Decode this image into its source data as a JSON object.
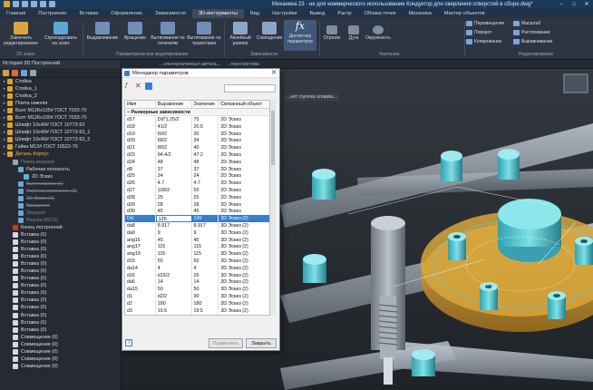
{
  "window": {
    "title": "Механика 23 - не для коммерческого использования Кондуктор для сверления отверстий в сборе.dwg*",
    "minimize": "–",
    "maximize": "□",
    "close": "✕"
  },
  "ribbon_tabs": [
    "Главная",
    "Построение",
    "Вставка",
    "Оформление",
    "Зависимости",
    "3D-инструменты",
    "Вид",
    "Настройки",
    "Вывод",
    "Растр",
    "Облака точек",
    "Механика",
    "Мастер объектов"
  ],
  "ribbon_active_tab": "3D-инструменты",
  "ribbon": {
    "buttons": [
      {
        "name": "close-editing",
        "label": "Закончить редактирование",
        "color": "#d9a441"
      },
      {
        "name": "project-sketch",
        "label": "Спроецировать на эскиз",
        "color": "#5aa6d6"
      },
      {
        "name": "extrude",
        "label": "Выдавливание",
        "color": "#6f8fb8"
      },
      {
        "name": "revolve",
        "label": "Вращение",
        "color": "#6f8fb8"
      },
      {
        "name": "loft",
        "label": "Вытягивание по сечениям",
        "color": "#6f8fb8"
      },
      {
        "name": "sweep",
        "label": "Вытягивание по траектории",
        "color": "#6f8fb8"
      },
      {
        "name": "linear-pattern",
        "label": "Линейный размер",
        "color": "#8aa6c9"
      },
      {
        "name": "coincidence",
        "label": "Совпадение",
        "color": "#8aa6c9"
      },
      {
        "name": "param-manager",
        "label": "Диспетчер параметров",
        "color": "#3f78c4"
      }
    ],
    "groups": {
      "sketch": "2D эскиз",
      "param": "Параметрическое моделирование",
      "constraints": "Зависимости",
      "drawing": "Черчение",
      "edit": "Редактирование"
    },
    "draw_tools": [
      "Отрезок",
      "Дуга",
      "Окружность"
    ],
    "edit_tools": [
      "Перемещение",
      "Поворот",
      "Копирование",
      "Масштаб",
      "Растягивание",
      "Выравнивание"
    ]
  },
  "left_panel": {
    "title": "История 3D Построений",
    "items": [
      {
        "label": "Стойка",
        "kind": "body",
        "state": "normal"
      },
      {
        "label": "Стойка_1",
        "kind": "body",
        "state": "normal"
      },
      {
        "label": "Стойка_2",
        "kind": "body",
        "state": "normal"
      },
      {
        "label": "Плита нижняя",
        "kind": "body",
        "state": "normal"
      },
      {
        "label": "Болт М12Кх125# ГОСТ 7033-70",
        "kind": "body",
        "state": "normal"
      },
      {
        "label": "Болт М12Кх100# ГОСТ 7033-70",
        "kind": "body",
        "state": "normal"
      },
      {
        "label": "Шпифт 10х40# ГОСТ 10773-93",
        "kind": "body",
        "state": "normal"
      },
      {
        "label": "Шпифт 10х40# ГОСТ 10773-93_1",
        "kind": "body",
        "state": "normal"
      },
      {
        "label": "Шпифт 10х40# ГОСТ 10773-93_2",
        "kind": "body",
        "state": "normal"
      },
      {
        "label": "Гайка М12# ГОСТ 15522-70",
        "kind": "body",
        "state": "normal"
      },
      {
        "label": "Деталь Корпус",
        "kind": "body",
        "state": "highlight"
      },
      {
        "label": "Плита верхняя",
        "kind": "sub",
        "state": "gray"
      },
      {
        "label": "Рабочая плоскость",
        "kind": "sub2",
        "state": "normal"
      },
      {
        "label": "2D Эскиз",
        "kind": "sub3",
        "state": "normal"
      },
      {
        "label": "Вытягивание (1)",
        "kind": "sub2",
        "state": "strike"
      },
      {
        "label": "Рабочая плоскость (2)",
        "kind": "sub2",
        "state": "strike"
      },
      {
        "label": "3D Эскиз (2)",
        "kind": "sub2",
        "state": "strike"
      },
      {
        "label": "Вращение",
        "kind": "sub2",
        "state": "strike"
      },
      {
        "label": "Зеркало",
        "kind": "sub2",
        "state": "gray"
      },
      {
        "label": "Резьба (8X12)",
        "kind": "sub2",
        "state": "gray"
      },
      {
        "label": "Конец построений",
        "kind": "end",
        "state": "normal"
      },
      {
        "label": "Вставка (0)",
        "kind": "ins",
        "state": "normal"
      },
      {
        "label": "Вставка (0)",
        "kind": "ins",
        "state": "normal"
      },
      {
        "label": "Вставка (0)",
        "kind": "ins",
        "state": "normal"
      },
      {
        "label": "Вставка (0)",
        "kind": "ins",
        "state": "normal"
      },
      {
        "label": "Вставка (0)",
        "kind": "ins",
        "state": "normal"
      },
      {
        "label": "Вставка (0)",
        "kind": "ins",
        "state": "normal"
      },
      {
        "label": "Вставка (0)",
        "kind": "ins",
        "state": "normal"
      },
      {
        "label": "Вставка (0)",
        "kind": "ins",
        "state": "normal"
      },
      {
        "label": "Вставка (0)",
        "kind": "ins",
        "state": "normal"
      },
      {
        "label": "Вставка (0)",
        "kind": "ins",
        "state": "normal"
      },
      {
        "label": "Вставка (0)",
        "kind": "ins",
        "state": "normal"
      },
      {
        "label": "Вставка (0)",
        "kind": "ins",
        "state": "normal"
      },
      {
        "label": "Вставка (0)",
        "kind": "ins",
        "state": "normal"
      },
      {
        "label": "Вставка (0)",
        "kind": "ins",
        "state": "normal"
      },
      {
        "label": "Совмещение (0)",
        "kind": "ins",
        "state": "normal"
      },
      {
        "label": "Совмещение (0)",
        "kind": "ins",
        "state": "normal"
      },
      {
        "label": "Совмещение (0)",
        "kind": "ins",
        "state": "normal"
      },
      {
        "label": "Совмещение (0)",
        "kind": "ins",
        "state": "normal"
      },
      {
        "label": "Совмещение (0)",
        "kind": "ins",
        "state": "normal"
      }
    ]
  },
  "viewport": {
    "doc_tab": "...эльтернатиеныт-деталь...",
    "view_label": "...перспектива",
    "hint_label": "...нет горячих клавиш..."
  },
  "dialog": {
    "title": "Менеджер параметров",
    "close": "✕",
    "columns": [
      "Имя",
      "Выражение",
      "Значение",
      "Связанный объект"
    ],
    "section": "Размерные зависимости",
    "rows": [
      {
        "name": "d17",
        "expr": "Dd*1.25/2",
        "value": "75",
        "obj": "2D Эскиз"
      },
      {
        "name": "d18",
        "expr": "41/2",
        "value": "20.5",
        "obj": "2D Эскиз"
      },
      {
        "name": "d19",
        "expr": "60/2",
        "value": "30",
        "obj": "2D Эскиз"
      },
      {
        "name": "d20",
        "expr": "68/2",
        "value": "34",
        "obj": "2D Эскиз"
      },
      {
        "name": "d21",
        "expr": "80/2",
        "value": "40",
        "obj": "2D Эскиз"
      },
      {
        "name": "d23",
        "expr": "94.4/2",
        "value": "47.2",
        "obj": "2D Эскиз"
      },
      {
        "name": "d24",
        "expr": "48",
        "value": "48",
        "obj": "2D Эскиз"
      },
      {
        "name": "d8",
        "expr": "37",
        "value": "37",
        "obj": "2D Эскиз"
      },
      {
        "name": "d25",
        "expr": "24",
        "value": "24",
        "obj": "2D Эскиз"
      },
      {
        "name": "d26",
        "expr": "4.7",
        "value": "4.7",
        "obj": "2D Эскиз"
      },
      {
        "name": "d27",
        "expr": "100/2",
        "value": "50",
        "obj": "2D Эскиз"
      },
      {
        "name": "d28",
        "expr": "25",
        "value": "25",
        "obj": "2D Эскиз"
      },
      {
        "name": "d29",
        "expr": "28",
        "value": "28",
        "obj": "2D Эскиз"
      },
      {
        "name": "d30",
        "expr": "45",
        "value": "45",
        "obj": "2D Эскиз"
      },
      {
        "name": "Dd",
        "expr": "120",
        "value": "120",
        "obj": "3D Эскиз (2)",
        "selected": true
      },
      {
        "name": "da8",
        "expr": "8.917",
        "value": "8.917",
        "obj": "3D Эскиз (2)"
      },
      {
        "name": "da9",
        "expr": "9",
        "value": "9",
        "obj": "3D Эскиз (2)"
      },
      {
        "name": "ang16",
        "expr": "45",
        "value": "45",
        "obj": "3D Эскиз (2)"
      },
      {
        "name": "ang17",
        "expr": "115",
        "value": "115",
        "obj": "3D Эскиз (2)"
      },
      {
        "name": "ang19",
        "expr": "115",
        "value": "115",
        "obj": "3D Эскиз (2)"
      },
      {
        "name": "d15",
        "expr": "50",
        "value": "50",
        "obj": "3D Эскиз (2)"
      },
      {
        "name": "da14",
        "expr": "4",
        "value": "4",
        "obj": "3D Эскиз (2)"
      },
      {
        "name": "d16",
        "expr": "d15/2",
        "value": "25",
        "obj": "3D Эскиз (2)"
      },
      {
        "name": "da6",
        "expr": "14",
        "value": "14",
        "obj": "3D Эскиз (2)"
      },
      {
        "name": "da15",
        "expr": "50",
        "value": "50",
        "obj": "3D Эскиз (2)"
      },
      {
        "name": "d1",
        "expr": "d2/2",
        "value": "90",
        "obj": "3D Эскиз (2)"
      },
      {
        "name": "d2",
        "expr": "180",
        "value": "180",
        "obj": "3D Эскиз (2)"
      },
      {
        "name": "d3",
        "expr": "19.5",
        "value": "19.5",
        "obj": "3D Эскиз (2)"
      },
      {
        "name": "d5",
        "expr": "9",
        "value": "9",
        "obj": "3D Эскиз (2)"
      }
    ],
    "help": "?",
    "apply_label": "Применить",
    "close_label": "Закрыть"
  }
}
